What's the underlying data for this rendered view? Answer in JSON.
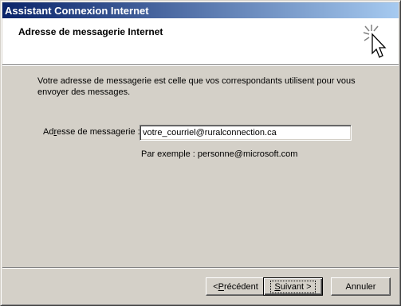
{
  "window": {
    "title": "Assistant Connexion Internet"
  },
  "header": {
    "title": "Adresse de messagerie Internet",
    "icon": "wizard-cursor-sparkle-icon"
  },
  "content": {
    "description": "Votre adresse de messagerie est celle que vos correspondants utilisent pour vous envoyer des messages.",
    "email_label_pre": "Ad",
    "email_label_ul": "r",
    "email_label_post": "esse de messagerie :",
    "email_value": "votre_courriel@ruralconnection.ca",
    "example": "Par exemple : personne@microsoft.com"
  },
  "buttons": {
    "prev_pre": "< ",
    "prev_ul": "P",
    "prev_post": "récédent",
    "next_ul": "S",
    "next_post": "uivant >",
    "cancel": "Annuler"
  }
}
